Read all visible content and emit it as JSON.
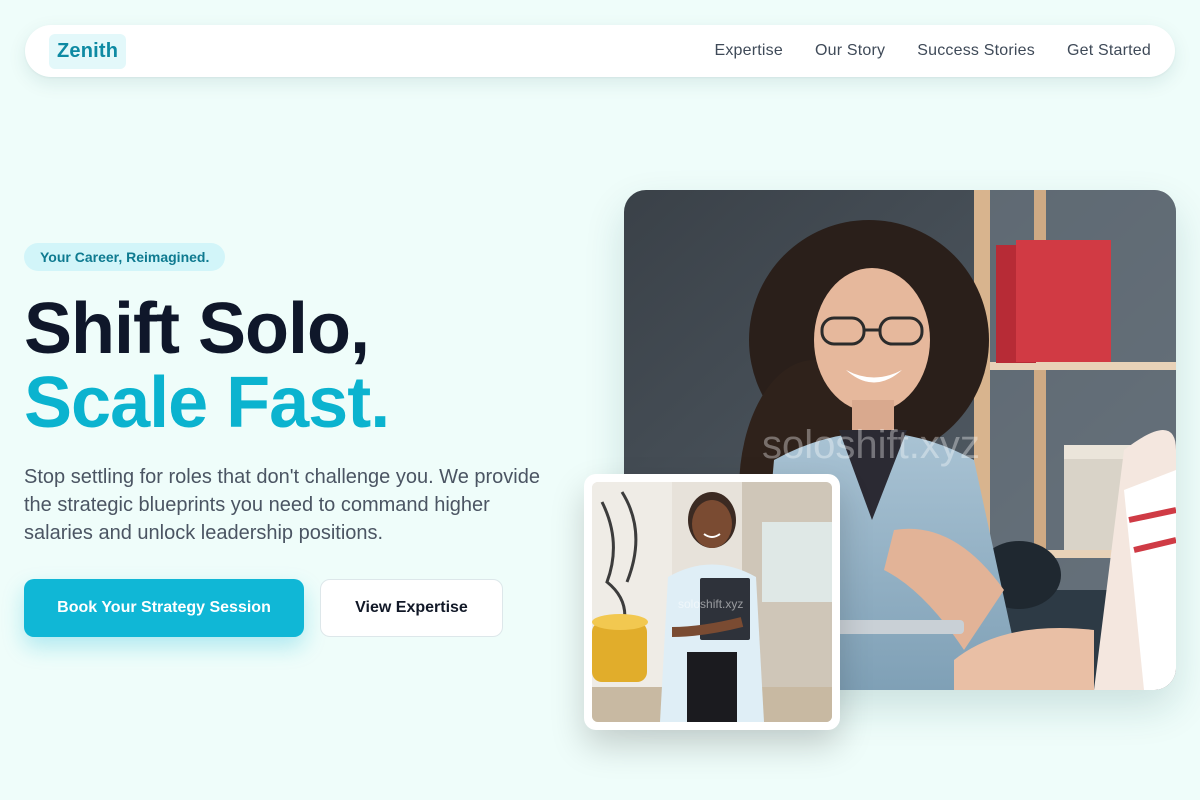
{
  "nav": {
    "logo": "Zenith",
    "links": [
      "Expertise",
      "Our Story",
      "Success Stories",
      "Get Started"
    ]
  },
  "hero": {
    "tagline": "Your Career, Reimagined.",
    "headline_line1": "Shift Solo,",
    "headline_line2": "Scale Fast.",
    "description": "Stop settling for roles that don't challenge you. We provide the strategic blueprints you need to command higher salaries and unlock leadership positions.",
    "primary_cta": "Book Your Strategy Session",
    "secondary_cta": "View Expertise"
  },
  "images": {
    "main_watermark": "soloshift.xyz",
    "small_watermark": "soloshift.xyz"
  },
  "colors": {
    "background": "#effdfa",
    "accent": "#10b7d6",
    "headline_dark": "#0f172a",
    "headline_accent": "#0bb3cf",
    "logo_bg": "#e3f8fa"
  }
}
